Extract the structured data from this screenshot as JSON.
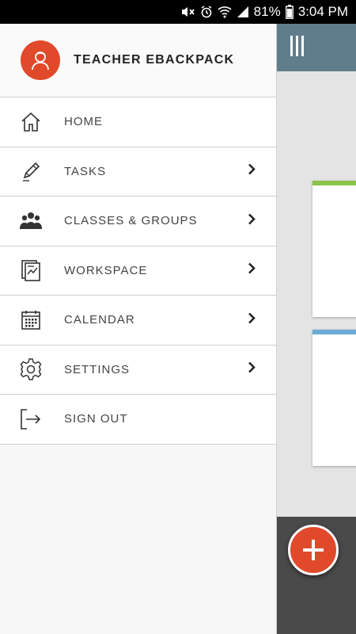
{
  "status_bar": {
    "battery": "81%",
    "time": "3:04 PM"
  },
  "drawer": {
    "app_title": "TEACHER EBACKPACK",
    "items": [
      {
        "label": "HOME",
        "icon": "home-icon",
        "has_chevron": false
      },
      {
        "label": "TASKS",
        "icon": "pencil-icon",
        "has_chevron": true
      },
      {
        "label": "CLASSES & GROUPS",
        "icon": "group-icon",
        "has_chevron": true
      },
      {
        "label": "WORKSPACE",
        "icon": "workspace-icon",
        "has_chevron": true
      },
      {
        "label": "CALENDAR",
        "icon": "calendar-icon",
        "has_chevron": true
      },
      {
        "label": "SETTINGS",
        "icon": "gear-icon",
        "has_chevron": true
      },
      {
        "label": "SIGN OUT",
        "icon": "sign-out-icon",
        "has_chevron": false
      }
    ]
  },
  "colors": {
    "accent": "#e04a2a",
    "header_bar": "#607d8b",
    "card_green": "#8bc34a",
    "card_blue": "#6aaad4"
  }
}
